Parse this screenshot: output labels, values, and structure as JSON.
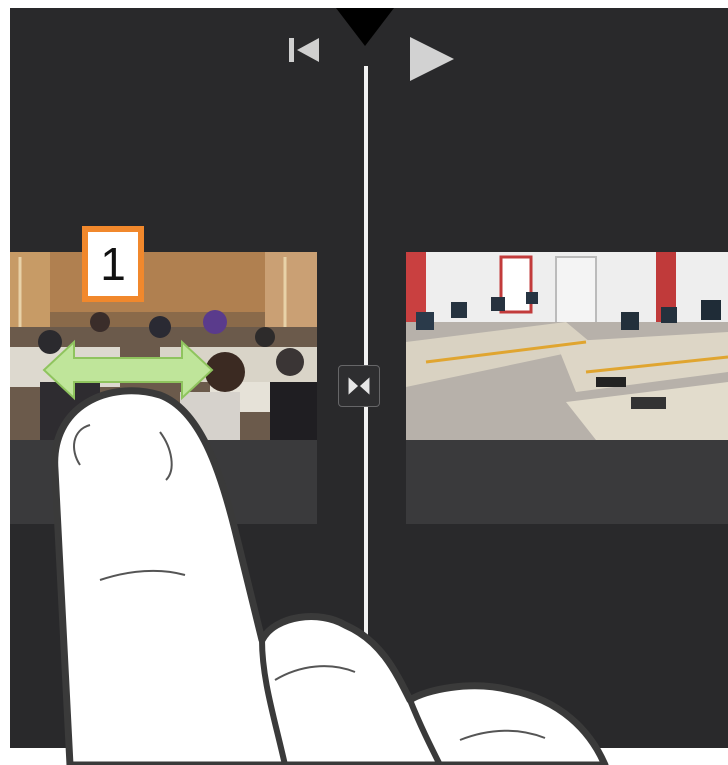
{
  "controls": {
    "skip_back_icon": "skip-to-start-icon",
    "play_icon": "play-icon",
    "playhead_marker_icon": "playhead-marker-icon"
  },
  "timeline": {
    "clips": [
      {
        "name": "classroom-students",
        "description_icon": "video-thumbnail"
      },
      {
        "name": "computer-lab",
        "description_icon": "video-thumbnail"
      }
    ],
    "transition_icon": "transition-icon"
  },
  "annotation": {
    "step_label": "1",
    "arrow_icon": "double-arrow-icon",
    "gesture_icon": "hand-pointer-icon",
    "badge_color": "#f1882c",
    "arrow_color": "#bfe59a"
  },
  "colors": {
    "background": "#29292b",
    "audio_lane": "#3a3a3c",
    "playhead": "#f2f2f2"
  }
}
